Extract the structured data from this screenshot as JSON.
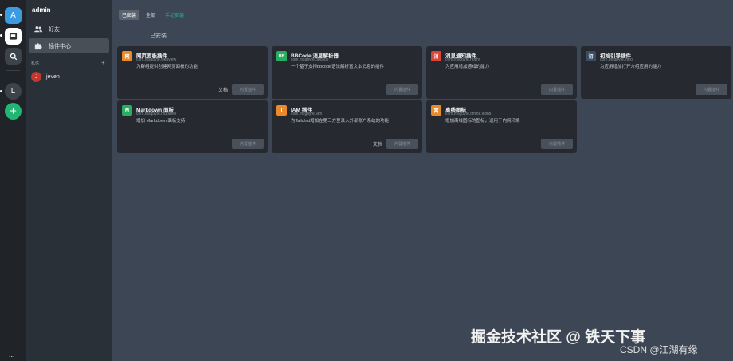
{
  "rail": {
    "avatar_letter": "A",
    "user_letter": "L",
    "add_symbol": "+",
    "more_symbol": "...",
    "accent_color": "#3b9be0",
    "add_color": "#22b573"
  },
  "sidebar": {
    "title": "admin",
    "items": [
      {
        "label": "好友",
        "icon": "users-icon"
      },
      {
        "label": "插件中心",
        "icon": "puzzle-icon"
      }
    ],
    "section_label": "私信",
    "add_symbol": "+",
    "users": [
      {
        "initial": "J",
        "name": "jeven",
        "color": "#c2372f"
      }
    ]
  },
  "main": {
    "tabs": [
      {
        "label": "已安装",
        "active": true
      },
      {
        "label": "全部",
        "active": false
      },
      {
        "label": "手动安装",
        "active": false,
        "link": true
      }
    ],
    "section_title": "已安装",
    "cards": [
      {
        "badge": "网",
        "badge_color": "#e98a2b",
        "name": "网页面板插件",
        "pkg": "com.msgbyte.webview",
        "desc": "为群组提供创建网页面板的功能",
        "doc": "文档",
        "action": "内置插件"
      },
      {
        "badge": "BB",
        "badge_color": "#27ae60",
        "name": "BBCode 消息解析器",
        "pkg": "com.msgbyte.bbcode",
        "desc": "一个基于支持bbcode语法解析富文本消息的插件",
        "doc": "",
        "action": "内置插件"
      },
      {
        "badge": "消",
        "badge_color": "#d8453b",
        "name": "消息通知插件",
        "pkg": "com.msgbyte.notify",
        "desc": "为应用增加通知的能力",
        "doc": "",
        "action": "内置插件"
      },
      {
        "badge": "初",
        "badge_color": "#3a4d63",
        "name": "初始引导插件",
        "pkg": "com.msgbyte.intro",
        "desc": "为应用增加打开介绍应用的能力",
        "doc": "",
        "action": "内置插件"
      },
      {
        "badge": "M",
        "badge_color": "#27ae60",
        "name": "Markdown 面板",
        "pkg": "com.msgbyte.mdpanel",
        "desc": "增加 Markdown 面板支持",
        "doc": "",
        "action": "内置插件"
      },
      {
        "badge": "I",
        "badge_color": "#e98a2b",
        "name": "IAM 插件",
        "pkg": "com.msgbyte.iam",
        "desc": "为Tailchat增加在第三方登录入外部账户系统的功能",
        "doc": "文档",
        "action": "内置插件"
      },
      {
        "badge": "离",
        "badge_color": "#e98a2b",
        "name": "离线图标",
        "pkg": "com.msgbyte.offline.icons",
        "desc": "增加离线图标的图标，适用于内网环境",
        "doc": "",
        "action": "内置插件"
      }
    ]
  },
  "watermark": {
    "main": "掘金技术社区 @ 铁天下事",
    "sub": "CSDN @江湖有缘"
  }
}
